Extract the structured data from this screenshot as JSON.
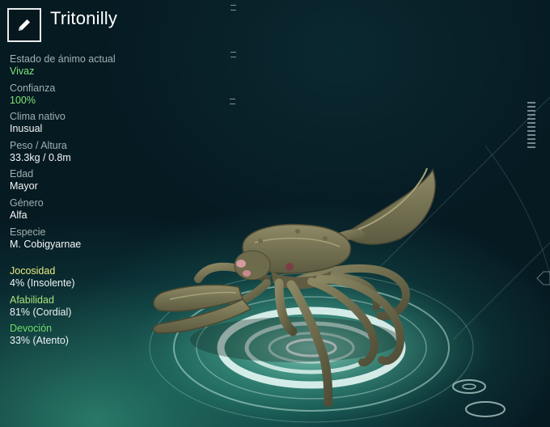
{
  "creature": {
    "name": "Tritonilly"
  },
  "stats": [
    {
      "label": "Estado de ánimo actual",
      "value": "Vivaz"
    },
    {
      "label": "Confianza",
      "value": "100%"
    },
    {
      "label": "Clima nativo",
      "value": "Inusual"
    },
    {
      "label": "Peso / Altura",
      "value": "33.3kg / 0.8m"
    },
    {
      "label": "Edad",
      "value": "Mayor"
    },
    {
      "label": "Género",
      "value": "Alfa"
    },
    {
      "label": "Especie",
      "value": "M. Cobigyarnae"
    }
  ],
  "traits": [
    {
      "label": "Jocosidad",
      "value": "4% (Insolente)"
    },
    {
      "label": "Afabilidad",
      "value": "81% (Cordial)"
    },
    {
      "label": "Devoción",
      "value": "33% (Atento)"
    }
  ],
  "icons": {
    "edit": "pencil-icon"
  },
  "colors": {
    "accent_green": "#7fe57a",
    "trait_yellow": "#e6ec7a",
    "trait_green_light": "#a8e27a",
    "trait_green": "#6fdc6a",
    "label_gray": "#9fb0b0"
  }
}
